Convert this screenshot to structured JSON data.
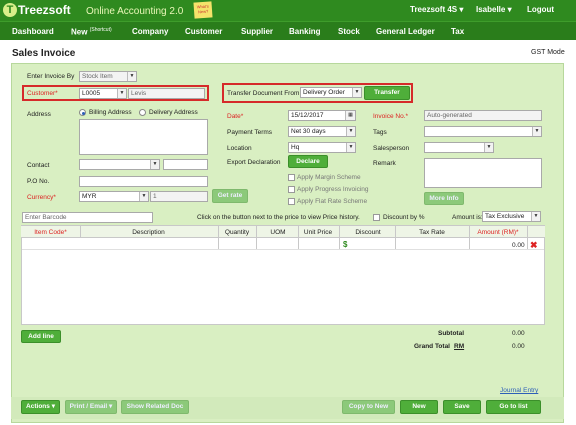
{
  "brand": {
    "logo_letter": "T",
    "name": "Treezsoft",
    "app": "Online Accounting 2.0",
    "note": "What's New?"
  },
  "top_menu": {
    "company": "Treezsoft 4S ▾",
    "user": "Isabelle ▾",
    "logout": "Logout"
  },
  "nav": [
    "Dashboard",
    "New",
    "Company",
    "Customer",
    "Supplier",
    "Banking",
    "Stock",
    "General Ledger",
    "Tax"
  ],
  "nav_shortcut": "(Shortcut)",
  "page": {
    "title": "Sales Invoice",
    "mode": "GST Mode"
  },
  "form": {
    "enter_by_label": "Enter Invoice By",
    "enter_by_value": "Stock Item",
    "customer_label": "Customer*",
    "customer_code": "L0005",
    "customer_name": "Levis",
    "transfer_label": "Transfer Document From",
    "transfer_value": "Delivery Order",
    "transfer_button": "Transfer",
    "address_label": "Address",
    "billing_label": "Billing Address",
    "delivery_label": "Delivery Address",
    "contact_label": "Contact",
    "po_label": "P.O No.",
    "currency_label": "Currency*",
    "currency_value": "MYR",
    "rate_value": "1",
    "get_rate": "Get rate",
    "date_label": "Date*",
    "date_value": "15/12/2017",
    "terms_label": "Payment Terms",
    "terms_value": "Net 30 days",
    "location_label": "Location",
    "location_value": "Hq",
    "export_label": "Export Declaration",
    "declare_button": "Declare",
    "margin_label": "Apply Margin Scheme",
    "progress_label": "Apply Progress Invoicing",
    "flat_label": "Apply Flat Rate Scheme",
    "invoice_no_label": "Invoice No.*",
    "invoice_no_value": "Auto-generated",
    "tags_label": "Tags",
    "salesperson_label": "Salesperson",
    "remark_label": "Remark",
    "more_info": "More Info"
  },
  "barcode": {
    "placeholder": "Enter Barcode",
    "hint": "Click on the button next to the price to view Price history.",
    "discount_label": "Discount by %",
    "amount_is_label": "Amount is:",
    "amount_is_value": "Tax Exclusive"
  },
  "grid": {
    "columns": [
      "Item Code*",
      "Description",
      "Quantity",
      "UOM",
      "Unit Price",
      "Discount",
      "Tax Rate",
      "Amount (RM)*"
    ],
    "row": {
      "amount": "0.00",
      "price_icon": "$"
    }
  },
  "add_line": "Add line",
  "totals": {
    "subtotal_label": "Subtotal",
    "subtotal_value": "0.00",
    "grand_label": "Grand Total",
    "currency": "RM",
    "grand_value": "0.00"
  },
  "journal_link": "Journal Entry",
  "actions": {
    "actions": "Actions ▾",
    "print": "Print / Email ▾",
    "related": "Show Related Doc",
    "copy": "Copy to New",
    "new": "New",
    "save": "Save",
    "goto": "Go to list"
  },
  "colors": {
    "brand_green": "#2f8a1f",
    "panel": "#d9efc2",
    "highlight_red": "#d62a2a"
  }
}
